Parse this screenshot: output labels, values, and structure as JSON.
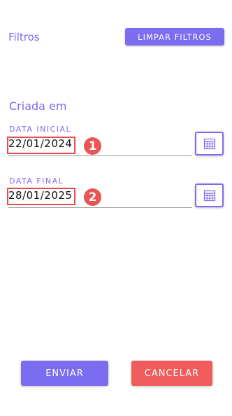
{
  "header": {
    "title": "Filtros",
    "clear_button_label": "LIMPAR FILTROS"
  },
  "section": {
    "title": "Criada em"
  },
  "fields": {
    "start": {
      "label": "DATA INICIAL",
      "value": "22/01/2024",
      "marker": "1",
      "calendar_icon": "calendar-icon"
    },
    "end": {
      "label": "DATA FINAL",
      "value": "28/01/2025",
      "marker": "2",
      "calendar_icon": "calendar-icon"
    }
  },
  "actions": {
    "send_label": "ENVIAR",
    "cancel_label": "CANCELAR"
  },
  "colors": {
    "accent": "#7b6cf0",
    "danger": "#f05b5b",
    "annotation": "#e34d4d"
  }
}
